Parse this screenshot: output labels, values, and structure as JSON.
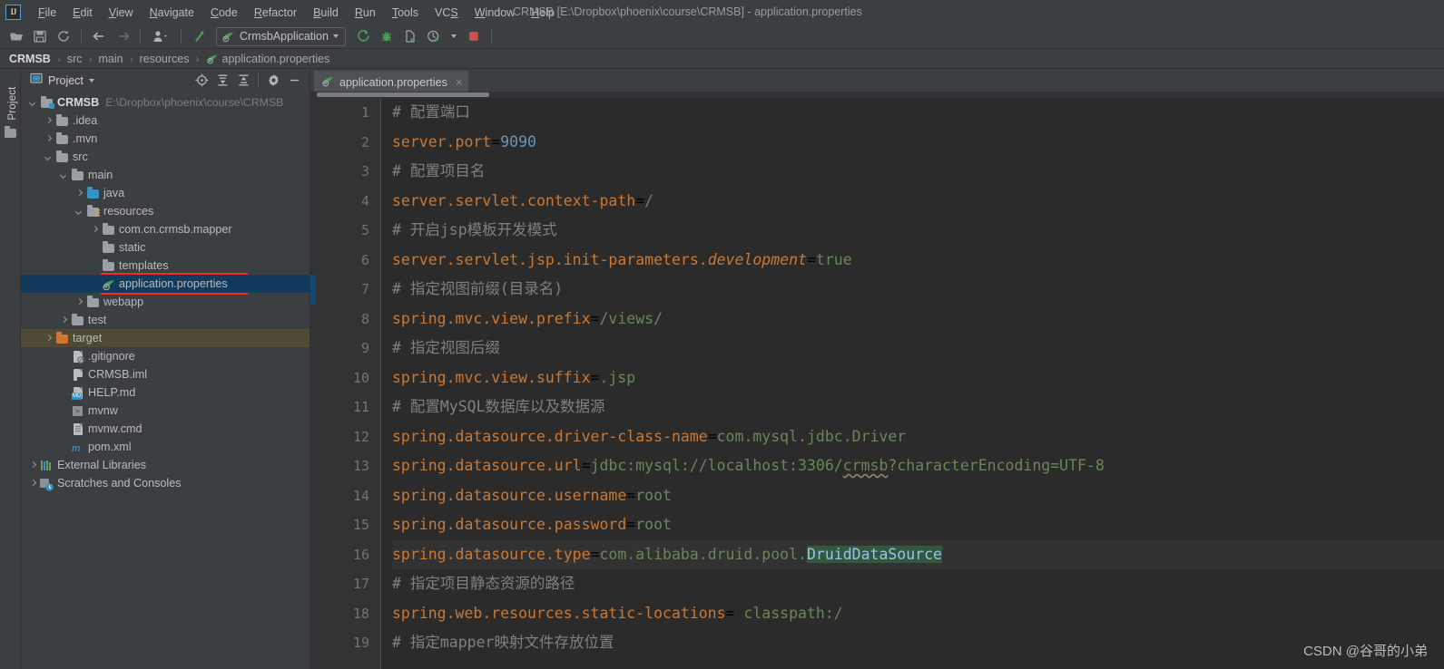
{
  "window": {
    "title": "CRMSB [E:\\Dropbox\\phoenix\\course\\CRMSB] - application.properties",
    "logo": "IJ"
  },
  "menu": {
    "items": [
      {
        "label": "File",
        "mnemonic": "F"
      },
      {
        "label": "Edit",
        "mnemonic": "E"
      },
      {
        "label": "View",
        "mnemonic": "V"
      },
      {
        "label": "Navigate",
        "mnemonic": "N"
      },
      {
        "label": "Code",
        "mnemonic": "C"
      },
      {
        "label": "Refactor",
        "mnemonic": "R"
      },
      {
        "label": "Build",
        "mnemonic": "B"
      },
      {
        "label": "Run",
        "mnemonic": "R"
      },
      {
        "label": "Tools",
        "mnemonic": "T"
      },
      {
        "label": "VCS",
        "mnemonic": "S"
      },
      {
        "label": "Window",
        "mnemonic": "W"
      },
      {
        "label": "Help",
        "mnemonic": "H"
      }
    ]
  },
  "toolbar": {
    "open_icon": "open-folder-icon",
    "save_icon": "save-icon",
    "sync_icon": "sync-refresh-icon",
    "back_icon": "navigate-back-icon",
    "forward_icon": "navigate-forward-icon",
    "profile_icon": "user-profile-icon",
    "update_icon": "update-project-icon",
    "run_config_name": "CrmsbApplication",
    "run_icon": "run-icon",
    "debug_icon": "debug-bug-icon",
    "coverage_icon": "run-with-coverage-icon",
    "profiler_icon": "profiler-icon",
    "stop_icon": "stop-icon"
  },
  "breadcrumb": {
    "items": [
      "CRMSB",
      "src",
      "main",
      "resources",
      "application.properties"
    ],
    "separator": "›",
    "file_icon": "spring-properties-icon"
  },
  "tool_strip": {
    "project_tab": "Project",
    "folder_icon": "folder-icon"
  },
  "project_panel": {
    "title": "Project",
    "view_icon": "project-view-icon",
    "dropdown_icon": "chevron-down-icon",
    "locate_icon": "scroll-from-source-icon",
    "expand_icon": "expand-all-icon",
    "collapse_icon": "collapse-all-icon",
    "settings_icon": "gear-icon",
    "hide_icon": "minimize-icon",
    "tree": [
      {
        "label": "CRMSB",
        "sub": "E:\\Dropbox\\phoenix\\course\\CRMSB",
        "indent": 0,
        "arrow": "down",
        "icon": "module-folder-icon",
        "bold": true,
        "state": "normal"
      },
      {
        "label": ".idea",
        "sub": "",
        "indent": 1,
        "arrow": "right",
        "icon": "folder-icon",
        "bold": false,
        "state": "normal"
      },
      {
        "label": ".mvn",
        "sub": "",
        "indent": 1,
        "arrow": "right",
        "icon": "folder-icon",
        "bold": false,
        "state": "normal"
      },
      {
        "label": "src",
        "sub": "",
        "indent": 1,
        "arrow": "down",
        "icon": "folder-icon",
        "bold": false,
        "state": "normal"
      },
      {
        "label": "main",
        "sub": "",
        "indent": 2,
        "arrow": "down",
        "icon": "folder-icon",
        "bold": false,
        "state": "normal"
      },
      {
        "label": "java",
        "sub": "",
        "indent": 3,
        "arrow": "right",
        "icon": "source-root-icon",
        "bold": false,
        "state": "normal"
      },
      {
        "label": "resources",
        "sub": "",
        "indent": 3,
        "arrow": "down",
        "icon": "resource-root-icon",
        "bold": false,
        "state": "normal"
      },
      {
        "label": "com.cn.crmsb.mapper",
        "sub": "",
        "indent": 4,
        "arrow": "right",
        "icon": "folder-icon",
        "bold": false,
        "state": "normal"
      },
      {
        "label": "static",
        "sub": "",
        "indent": 4,
        "arrow": "none",
        "icon": "folder-icon",
        "bold": false,
        "state": "normal"
      },
      {
        "label": "templates",
        "sub": "",
        "indent": 4,
        "arrow": "none",
        "icon": "folder-icon",
        "bold": false,
        "state": "normal"
      },
      {
        "label": "application.properties",
        "sub": "",
        "indent": 4,
        "arrow": "none",
        "icon": "spring-properties-icon",
        "bold": false,
        "state": "selected"
      },
      {
        "label": "webapp",
        "sub": "",
        "indent": 3,
        "arrow": "right",
        "icon": "folder-icon",
        "bold": false,
        "state": "normal"
      },
      {
        "label": "test",
        "sub": "",
        "indent": 2,
        "arrow": "right",
        "icon": "folder-icon",
        "bold": false,
        "state": "normal"
      },
      {
        "label": "target",
        "sub": "",
        "indent": 1,
        "arrow": "right",
        "icon": "excluded-folder-icon",
        "bold": false,
        "state": "highlighted"
      },
      {
        "label": ".gitignore",
        "sub": "",
        "indent": 2,
        "arrow": "none",
        "icon": "gitignore-file-icon",
        "bold": false,
        "state": "normal"
      },
      {
        "label": "CRMSB.iml",
        "sub": "",
        "indent": 2,
        "arrow": "none",
        "icon": "iml-file-icon",
        "bold": false,
        "state": "normal"
      },
      {
        "label": "HELP.md",
        "sub": "",
        "indent": 2,
        "arrow": "none",
        "icon": "markdown-file-icon",
        "bold": false,
        "state": "normal"
      },
      {
        "label": "mvnw",
        "sub": "",
        "indent": 2,
        "arrow": "none",
        "icon": "shell-script-icon",
        "bold": false,
        "state": "normal"
      },
      {
        "label": "mvnw.cmd",
        "sub": "",
        "indent": 2,
        "arrow": "none",
        "icon": "cmd-file-icon",
        "bold": false,
        "state": "normal"
      },
      {
        "label": "pom.xml",
        "sub": "",
        "indent": 2,
        "arrow": "none",
        "icon": "maven-pom-icon",
        "bold": false,
        "state": "normal"
      },
      {
        "label": "External Libraries",
        "sub": "",
        "indent": 0,
        "arrow": "right",
        "icon": "external-libraries-icon",
        "bold": false,
        "state": "normal"
      },
      {
        "label": "Scratches and Consoles",
        "sub": "",
        "indent": 0,
        "arrow": "right",
        "icon": "scratches-icon",
        "bold": false,
        "state": "normal"
      }
    ]
  },
  "editor": {
    "tab": {
      "label": "application.properties",
      "icon": "spring-properties-icon",
      "close": "×"
    },
    "current_line": 16,
    "lines": [
      {
        "n": 1,
        "segments": [
          {
            "t": "# 配置端口",
            "c": "cmt"
          }
        ]
      },
      {
        "n": 2,
        "segments": [
          {
            "t": "server.port",
            "c": "key"
          },
          {
            "t": "=",
            "c": "plain"
          },
          {
            "t": "9090",
            "c": "num"
          }
        ]
      },
      {
        "n": 3,
        "segments": [
          {
            "t": "# 配置项目名",
            "c": "cmt"
          }
        ]
      },
      {
        "n": 4,
        "segments": [
          {
            "t": "server.servlet.context-path",
            "c": "key"
          },
          {
            "t": "=",
            "c": "plain"
          },
          {
            "t": "/",
            "c": "val"
          }
        ]
      },
      {
        "n": 5,
        "segments": [
          {
            "t": "# 开启jsp模板开发模式",
            "c": "cmt"
          }
        ]
      },
      {
        "n": 6,
        "segments": [
          {
            "t": "server.servlet.jsp.init-parameters.",
            "c": "key"
          },
          {
            "t": "development",
            "c": "ital"
          },
          {
            "t": "=",
            "c": "plain"
          },
          {
            "t": "true",
            "c": "val"
          }
        ]
      },
      {
        "n": 7,
        "segments": [
          {
            "t": "# 指定视图前缀(目录名)",
            "c": "cmt"
          }
        ]
      },
      {
        "n": 8,
        "segments": [
          {
            "t": "spring.mvc.view.prefix",
            "c": "key"
          },
          {
            "t": "=",
            "c": "plain"
          },
          {
            "t": "/views/",
            "c": "val"
          }
        ]
      },
      {
        "n": 9,
        "segments": [
          {
            "t": "# 指定视图后缀",
            "c": "cmt"
          }
        ]
      },
      {
        "n": 10,
        "segments": [
          {
            "t": "spring.mvc.view.suffix",
            "c": "key"
          },
          {
            "t": "=",
            "c": "plain"
          },
          {
            "t": ".jsp",
            "c": "val"
          }
        ]
      },
      {
        "n": 11,
        "segments": [
          {
            "t": "# 配置MySQL数据库以及数据源",
            "c": "cmt"
          }
        ]
      },
      {
        "n": 12,
        "segments": [
          {
            "t": "spring.datasource.driver-class-name",
            "c": "key"
          },
          {
            "t": "=",
            "c": "plain"
          },
          {
            "t": "com.mysql.jdbc.Driver",
            "c": "val"
          }
        ]
      },
      {
        "n": 13,
        "segments": [
          {
            "t": "spring.datasource.url",
            "c": "key"
          },
          {
            "t": "=",
            "c": "plain"
          },
          {
            "t": "jdbc:mysql://localhost:3306/",
            "c": "val"
          },
          {
            "t": "crmsb",
            "c": "val-squiggle"
          },
          {
            "t": "?characterEncoding=UTF-8",
            "c": "val"
          }
        ]
      },
      {
        "n": 14,
        "segments": [
          {
            "t": "spring.datasource.username",
            "c": "key"
          },
          {
            "t": "=",
            "c": "plain"
          },
          {
            "t": "root",
            "c": "val"
          }
        ]
      },
      {
        "n": 15,
        "segments": [
          {
            "t": "spring.datasource.password",
            "c": "key"
          },
          {
            "t": "=",
            "c": "plain"
          },
          {
            "t": "root",
            "c": "val"
          }
        ]
      },
      {
        "n": 16,
        "segments": [
          {
            "t": "spring.datasource.type",
            "c": "key"
          },
          {
            "t": "=",
            "c": "plain"
          },
          {
            "t": "com.alibaba.druid.pool.",
            "c": "val"
          },
          {
            "t": "DruidDataSource",
            "c": "selected"
          }
        ]
      },
      {
        "n": 17,
        "segments": [
          {
            "t": "# 指定项目静态资源的路径",
            "c": "cmt"
          }
        ]
      },
      {
        "n": 18,
        "segments": [
          {
            "t": "spring.web.resources.static-locations",
            "c": "key"
          },
          {
            "t": "= ",
            "c": "plain"
          },
          {
            "t": "classpath:/",
            "c": "val"
          }
        ]
      },
      {
        "n": 19,
        "segments": [
          {
            "t": "# 指定mapper映射文件存放位置",
            "c": "cmt"
          }
        ]
      }
    ]
  },
  "watermark": "CSDN @谷哥的小弟",
  "colors": {
    "background": "#3c3f41",
    "editor_background": "#2b2b2b",
    "gutter": "#313335",
    "selection_blue": "#113a5c",
    "annotation_red": "#ff2a1f",
    "key_orange": "#cc7832",
    "value_green": "#6a8759",
    "number_blue": "#6897bb",
    "comment_gray": "#808080",
    "highlight_green": "#32593d"
  }
}
